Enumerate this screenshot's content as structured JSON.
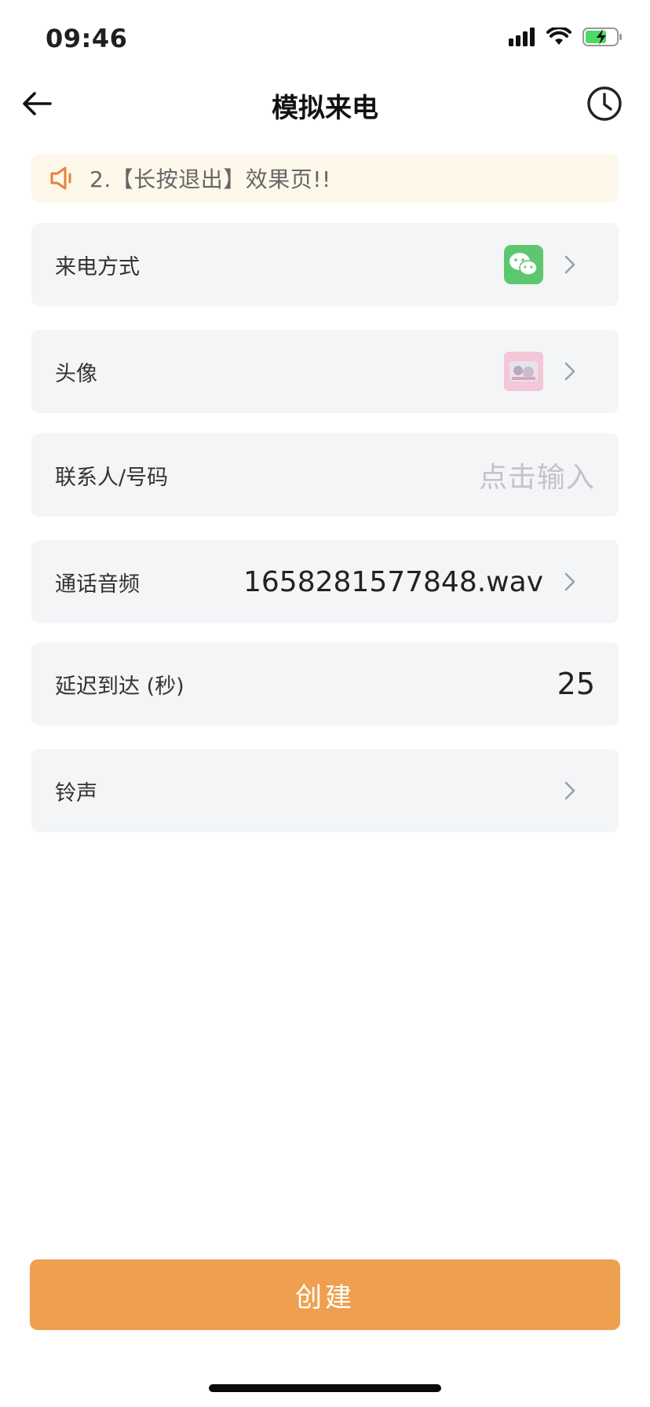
{
  "status_bar": {
    "time": "09:46"
  },
  "nav": {
    "title": "模拟来电"
  },
  "notice": {
    "text": "2.【长按退出】效果页!!"
  },
  "form": {
    "call_method": {
      "label": "来电方式",
      "icon": "wechat-icon"
    },
    "avatar": {
      "label": "头像",
      "icon": "avatar-thumbnail"
    },
    "contact": {
      "label": "联系人/号码",
      "placeholder": "点击输入"
    },
    "audio": {
      "label": "通话音频",
      "value": "1658281577848.wav"
    },
    "delay": {
      "label": "延迟到达 (秒)",
      "value": "25"
    },
    "ringtone": {
      "label": "铃声"
    }
  },
  "actions": {
    "create_label": "创建"
  },
  "colors": {
    "accent": "#eea050",
    "notice_bg": "#fdf8ea",
    "row_bg": "#f3f5f7",
    "wechat": "#5dc76f",
    "notice_icon": "#e8833a"
  }
}
